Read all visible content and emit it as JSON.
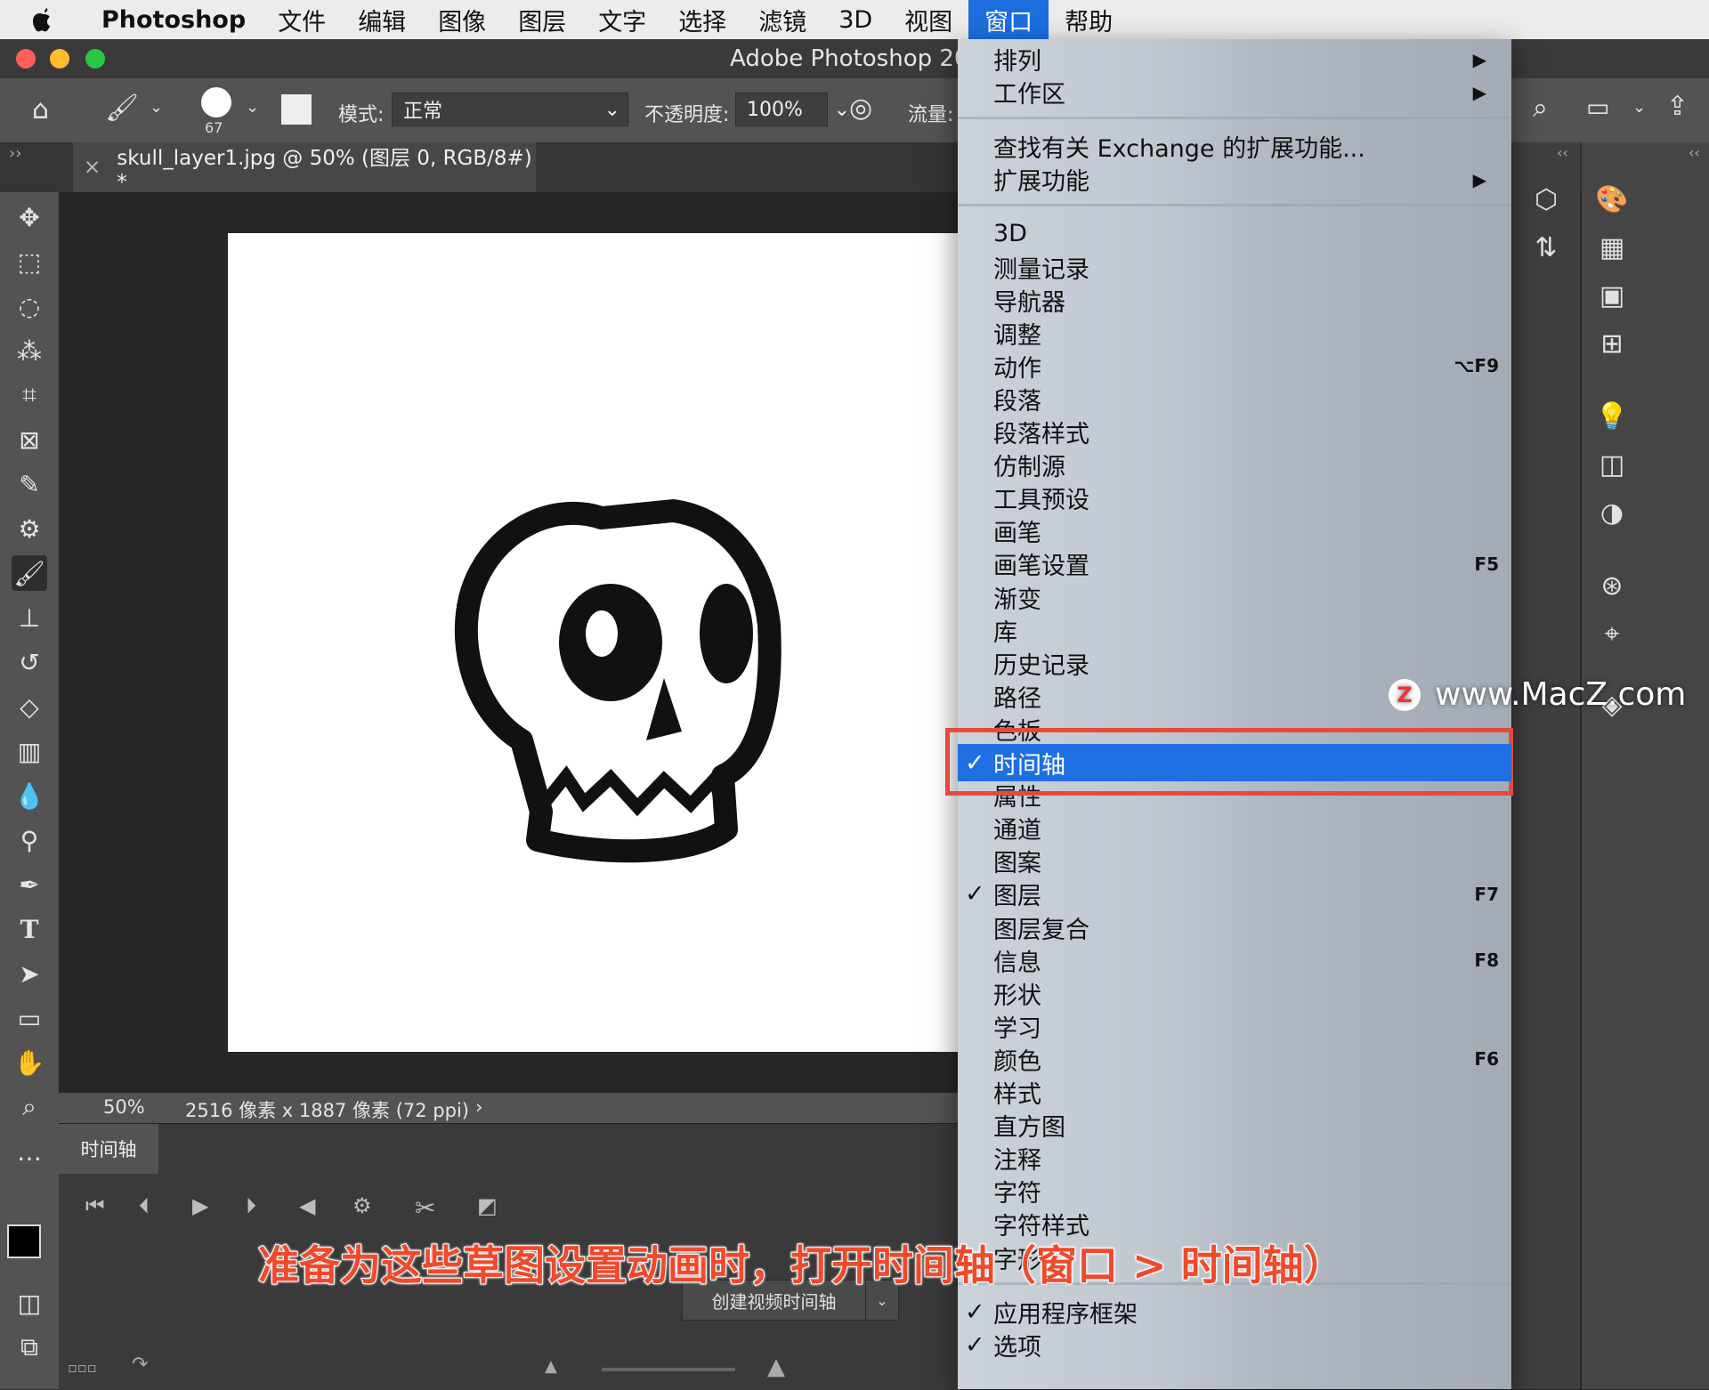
{
  "menubar": {
    "app": "Photoshop",
    "items": [
      "文件",
      "编辑",
      "图像",
      "图层",
      "文字",
      "选择",
      "滤镜",
      "3D",
      "视图",
      "窗口",
      "帮助"
    ],
    "active": "窗口"
  },
  "window": {
    "title": "Adobe Photoshop 202"
  },
  "options": {
    "brush_size": "67",
    "mode_label": "模式:",
    "mode_value": "正常",
    "opacity_label": "不透明度:",
    "opacity_value": "100%",
    "flow_label": "流量:"
  },
  "document": {
    "tab_title": "skull_layer1.jpg @ 50% (图层 0, RGB/8#) *",
    "zoom": "50%",
    "info": "2516 像素 x 1887 像素 (72 ppi)"
  },
  "timeline": {
    "tab_label": "时间轴",
    "create_button": "创建视频时间轴"
  },
  "menu": {
    "group1": [
      {
        "label": "排列",
        "submenu": true
      },
      {
        "label": "工作区",
        "submenu": true
      }
    ],
    "group2": [
      {
        "label": "查找有关 Exchange 的扩展功能..."
      },
      {
        "label": "扩展功能",
        "submenu": true
      }
    ],
    "group3": [
      {
        "label": "3D"
      },
      {
        "label": "测量记录"
      },
      {
        "label": "导航器"
      },
      {
        "label": "调整"
      },
      {
        "label": "动作",
        "shortcut": "⌥F9"
      },
      {
        "label": "段落"
      },
      {
        "label": "段落样式"
      },
      {
        "label": "仿制源"
      },
      {
        "label": "工具预设"
      },
      {
        "label": "画笔"
      },
      {
        "label": "画笔设置",
        "shortcut": "F5"
      },
      {
        "label": "渐变"
      },
      {
        "label": "库"
      },
      {
        "label": "历史记录"
      },
      {
        "label": "路径"
      },
      {
        "label": "色板"
      },
      {
        "label": "时间轴",
        "checked": true,
        "highlighted": true
      },
      {
        "label": "属性"
      },
      {
        "label": "通道"
      },
      {
        "label": "图案"
      },
      {
        "label": "图层",
        "checked": true,
        "shortcut": "F7"
      },
      {
        "label": "图层复合"
      },
      {
        "label": "信息",
        "shortcut": "F8"
      },
      {
        "label": "形状"
      },
      {
        "label": "学习"
      },
      {
        "label": "颜色",
        "shortcut": "F6"
      },
      {
        "label": "样式"
      },
      {
        "label": "直方图"
      },
      {
        "label": "注释"
      },
      {
        "label": "字符"
      },
      {
        "label": "字符样式"
      },
      {
        "label": "字形"
      }
    ],
    "group4": [
      {
        "label": "应用程序框架",
        "checked": true
      },
      {
        "label": "选项",
        "checked": true
      }
    ],
    "check_mark": "✓"
  },
  "watermark": {
    "logo": "Z",
    "text": "www.MacZ.com"
  },
  "caption": "准备为这些草图设置动画时，打开时间轴（窗口 > 时间轴）",
  "colors": {
    "accent": "#1e6fe3",
    "highlight_border": "#e64a3b",
    "caption": "#f04a2c"
  }
}
